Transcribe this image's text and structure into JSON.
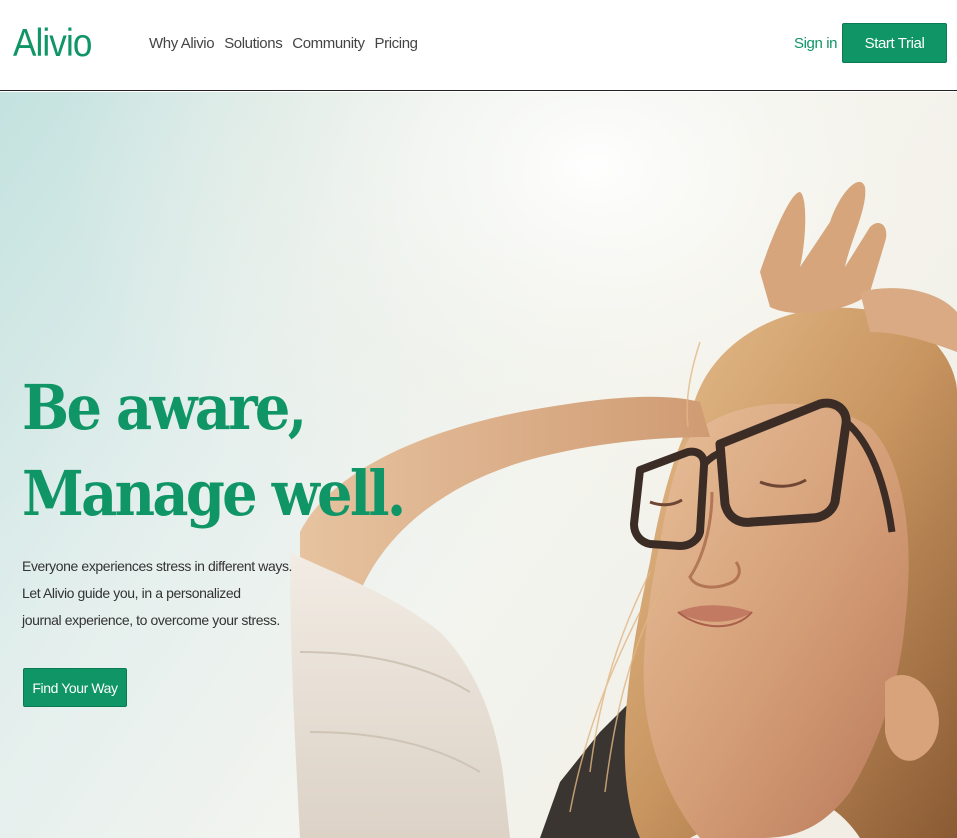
{
  "brand": {
    "name": "Alivio",
    "accent_color": "#0f9566"
  },
  "nav": {
    "links": [
      "Why Alivio",
      "Solutions",
      "Community",
      "Pricing"
    ],
    "signin_label": "Sign in",
    "trial_label": "Start Trial"
  },
  "hero": {
    "headline_line1": "Be aware,",
    "headline_line2": "Manage well.",
    "subtext_lines": [
      "Everyone experiences stress in different ways.",
      "Let Alivio guide you, in a personalized",
      "journal experience, to overcome your stress."
    ],
    "cta_label": "Find Your Way"
  }
}
